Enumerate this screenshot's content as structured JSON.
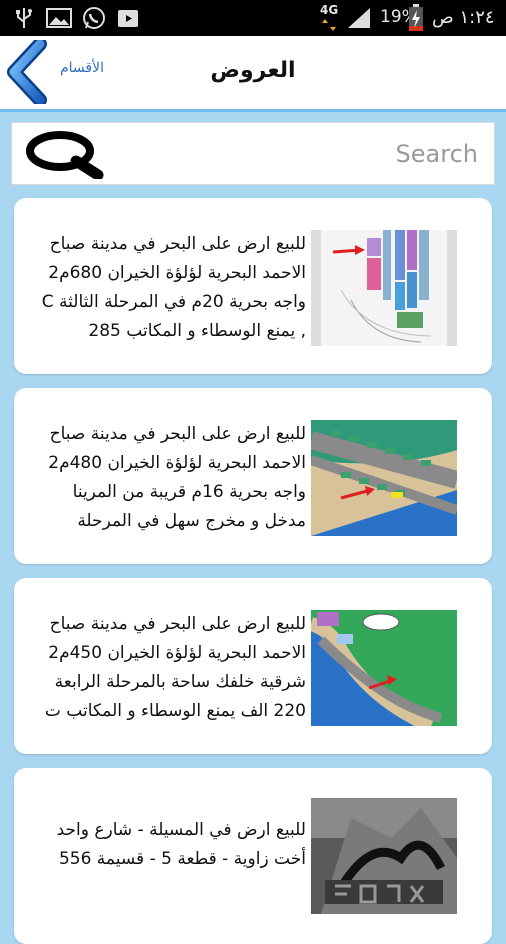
{
  "status_bar": {
    "time": "١:٢٤ ص",
    "battery": "19%",
    "network": "4G"
  },
  "header": {
    "title": "العروض",
    "back_label": "الأقسام"
  },
  "search": {
    "placeholder": "Search",
    "value": ""
  },
  "listings": [
    {
      "text": "للبيع ارض على البحر في مدينة صباح الاحمد البحرية لؤلؤة الخيران 680م2 واجه بحرية 20م في المرحلة الثالثة C ,  يمنع الوسطاء و المكاتب 285"
    },
    {
      "text": "للبيع ارض على البحر في مدينة صباح الاحمد البحرية لؤلؤة الخيران 480م2 واجه بحرية 16م قريبة من المرينا مدخل و مخرج سهل في المرحلة"
    },
    {
      "text": "للبيع ارض على البحر في مدينة صباح الاحمد البحرية لؤلؤة الخيران 450م2 شرقية خلفك ساحة بالمرحلة الرابعة 220 الف يمنع الوسطاء و المكاتب ت"
    },
    {
      "text": "للبيع ارض في المسيلة - شارع واحد أخت زاوية - قطعة 5 - قسيمة 556"
    }
  ],
  "colors": {
    "background": "#a9d6f1",
    "header_border": "#6fbbe9",
    "link": "#2d6fbf"
  }
}
